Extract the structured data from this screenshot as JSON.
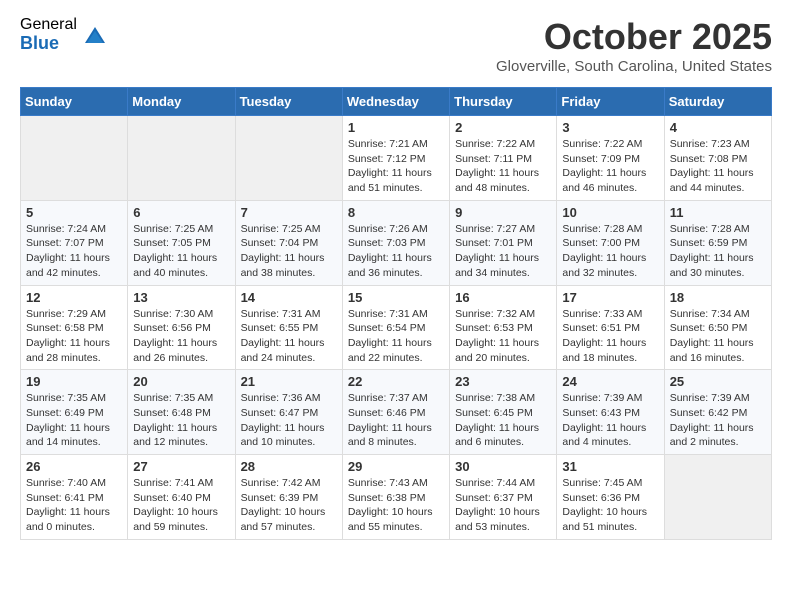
{
  "logo": {
    "general": "General",
    "blue": "Blue"
  },
  "header": {
    "month": "October 2025",
    "location": "Gloverville, South Carolina, United States"
  },
  "weekdays": [
    "Sunday",
    "Monday",
    "Tuesday",
    "Wednesday",
    "Thursday",
    "Friday",
    "Saturday"
  ],
  "weeks": [
    [
      {
        "day": "",
        "info": ""
      },
      {
        "day": "",
        "info": ""
      },
      {
        "day": "",
        "info": ""
      },
      {
        "day": "1",
        "info": "Sunrise: 7:21 AM\nSunset: 7:12 PM\nDaylight: 11 hours and 51 minutes."
      },
      {
        "day": "2",
        "info": "Sunrise: 7:22 AM\nSunset: 7:11 PM\nDaylight: 11 hours and 48 minutes."
      },
      {
        "day": "3",
        "info": "Sunrise: 7:22 AM\nSunset: 7:09 PM\nDaylight: 11 hours and 46 minutes."
      },
      {
        "day": "4",
        "info": "Sunrise: 7:23 AM\nSunset: 7:08 PM\nDaylight: 11 hours and 44 minutes."
      }
    ],
    [
      {
        "day": "5",
        "info": "Sunrise: 7:24 AM\nSunset: 7:07 PM\nDaylight: 11 hours and 42 minutes."
      },
      {
        "day": "6",
        "info": "Sunrise: 7:25 AM\nSunset: 7:05 PM\nDaylight: 11 hours and 40 minutes."
      },
      {
        "day": "7",
        "info": "Sunrise: 7:25 AM\nSunset: 7:04 PM\nDaylight: 11 hours and 38 minutes."
      },
      {
        "day": "8",
        "info": "Sunrise: 7:26 AM\nSunset: 7:03 PM\nDaylight: 11 hours and 36 minutes."
      },
      {
        "day": "9",
        "info": "Sunrise: 7:27 AM\nSunset: 7:01 PM\nDaylight: 11 hours and 34 minutes."
      },
      {
        "day": "10",
        "info": "Sunrise: 7:28 AM\nSunset: 7:00 PM\nDaylight: 11 hours and 32 minutes."
      },
      {
        "day": "11",
        "info": "Sunrise: 7:28 AM\nSunset: 6:59 PM\nDaylight: 11 hours and 30 minutes."
      }
    ],
    [
      {
        "day": "12",
        "info": "Sunrise: 7:29 AM\nSunset: 6:58 PM\nDaylight: 11 hours and 28 minutes."
      },
      {
        "day": "13",
        "info": "Sunrise: 7:30 AM\nSunset: 6:56 PM\nDaylight: 11 hours and 26 minutes."
      },
      {
        "day": "14",
        "info": "Sunrise: 7:31 AM\nSunset: 6:55 PM\nDaylight: 11 hours and 24 minutes."
      },
      {
        "day": "15",
        "info": "Sunrise: 7:31 AM\nSunset: 6:54 PM\nDaylight: 11 hours and 22 minutes."
      },
      {
        "day": "16",
        "info": "Sunrise: 7:32 AM\nSunset: 6:53 PM\nDaylight: 11 hours and 20 minutes."
      },
      {
        "day": "17",
        "info": "Sunrise: 7:33 AM\nSunset: 6:51 PM\nDaylight: 11 hours and 18 minutes."
      },
      {
        "day": "18",
        "info": "Sunrise: 7:34 AM\nSunset: 6:50 PM\nDaylight: 11 hours and 16 minutes."
      }
    ],
    [
      {
        "day": "19",
        "info": "Sunrise: 7:35 AM\nSunset: 6:49 PM\nDaylight: 11 hours and 14 minutes."
      },
      {
        "day": "20",
        "info": "Sunrise: 7:35 AM\nSunset: 6:48 PM\nDaylight: 11 hours and 12 minutes."
      },
      {
        "day": "21",
        "info": "Sunrise: 7:36 AM\nSunset: 6:47 PM\nDaylight: 11 hours and 10 minutes."
      },
      {
        "day": "22",
        "info": "Sunrise: 7:37 AM\nSunset: 6:46 PM\nDaylight: 11 hours and 8 minutes."
      },
      {
        "day": "23",
        "info": "Sunrise: 7:38 AM\nSunset: 6:45 PM\nDaylight: 11 hours and 6 minutes."
      },
      {
        "day": "24",
        "info": "Sunrise: 7:39 AM\nSunset: 6:43 PM\nDaylight: 11 hours and 4 minutes."
      },
      {
        "day": "25",
        "info": "Sunrise: 7:39 AM\nSunset: 6:42 PM\nDaylight: 11 hours and 2 minutes."
      }
    ],
    [
      {
        "day": "26",
        "info": "Sunrise: 7:40 AM\nSunset: 6:41 PM\nDaylight: 11 hours and 0 minutes."
      },
      {
        "day": "27",
        "info": "Sunrise: 7:41 AM\nSunset: 6:40 PM\nDaylight: 10 hours and 59 minutes."
      },
      {
        "day": "28",
        "info": "Sunrise: 7:42 AM\nSunset: 6:39 PM\nDaylight: 10 hours and 57 minutes."
      },
      {
        "day": "29",
        "info": "Sunrise: 7:43 AM\nSunset: 6:38 PM\nDaylight: 10 hours and 55 minutes."
      },
      {
        "day": "30",
        "info": "Sunrise: 7:44 AM\nSunset: 6:37 PM\nDaylight: 10 hours and 53 minutes."
      },
      {
        "day": "31",
        "info": "Sunrise: 7:45 AM\nSunset: 6:36 PM\nDaylight: 10 hours and 51 minutes."
      },
      {
        "day": "",
        "info": ""
      }
    ]
  ]
}
